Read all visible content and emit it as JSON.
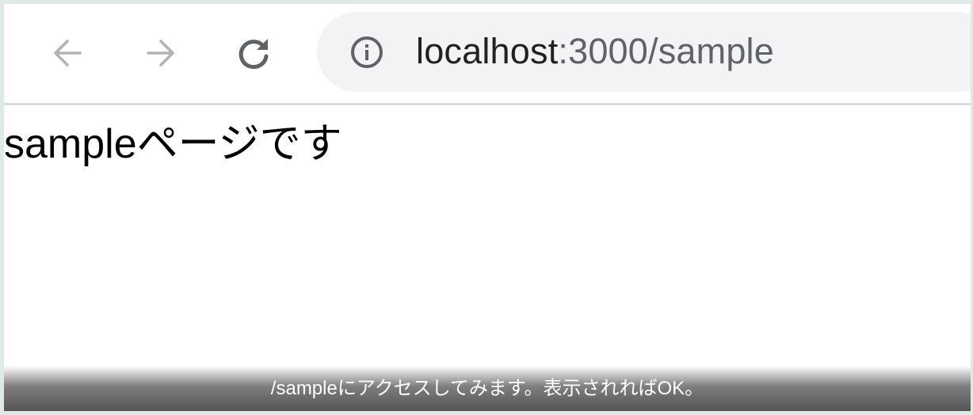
{
  "browser": {
    "nav": {
      "back_icon": "arrow-left-icon",
      "forward_icon": "arrow-right-icon",
      "reload_icon": "reload-icon"
    },
    "omnibox": {
      "info_icon": "info-icon",
      "url_host": "localhost",
      "url_rest": ":3000/sample"
    }
  },
  "page": {
    "heading": "sampleページです"
  },
  "caption": {
    "text": "/sampleにアクセスしてみます。表示されればOK。"
  },
  "colors": {
    "toolbar_bg": "#ffffff",
    "omnibox_bg": "#f1f3f4",
    "icon_disabled": "#b3b3b3",
    "icon_enabled": "#5f6368",
    "url_host": "#202124",
    "url_rest": "#5f6368"
  }
}
